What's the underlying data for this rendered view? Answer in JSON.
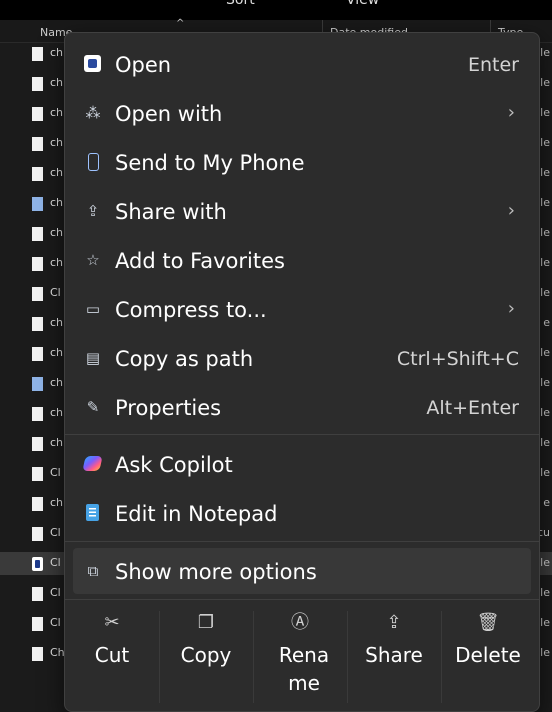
{
  "explorer": {
    "top_tabs": [
      "Sort",
      "View"
    ],
    "columns": {
      "name": "Name",
      "date": "Date modified",
      "type": "Type"
    },
    "files": [
      {
        "name": "ch",
        "type": "ile",
        "icon": "file-icon"
      },
      {
        "name": "ch",
        "type": "File",
        "icon": "file-icon"
      },
      {
        "name": "ch",
        "type": "ile",
        "icon": "file-icon"
      },
      {
        "name": "ch",
        "type": "le",
        "icon": "file-icon"
      },
      {
        "name": "ch",
        "type": "le",
        "icon": "file-icon"
      },
      {
        "name": "ch",
        "type": "le",
        "icon": "notepad-file-icon"
      },
      {
        "name": "ch",
        "type": "ile",
        "icon": "file-icon"
      },
      {
        "name": "ch",
        "type": "File",
        "icon": "file-icon"
      },
      {
        "name": "Cl",
        "type": "ile",
        "icon": "file-icon"
      },
      {
        "name": "ch",
        "type": "e",
        "icon": "file-icon"
      },
      {
        "name": "ch",
        "type": "le",
        "icon": "file-icon"
      },
      {
        "name": "ch",
        "type": "le",
        "icon": "notepad-file-icon"
      },
      {
        "name": "ch",
        "type": "ile",
        "icon": "file-icon"
      },
      {
        "name": "ch",
        "type": "File",
        "icon": "file-icon"
      },
      {
        "name": "Cl",
        "type": "ile",
        "icon": "file-icon"
      },
      {
        "name": "ch",
        "type": "e",
        "icon": "file-icon"
      },
      {
        "name": "Cl",
        "type": "ocu",
        "icon": "document-file-icon"
      },
      {
        "name": "Cl",
        "type": "ile",
        "icon": "app-file-icon"
      },
      {
        "name": "Cl",
        "type": "le",
        "icon": "file-icon"
      },
      {
        "name": "Cl",
        "type": "ile",
        "icon": "file-icon"
      },
      {
        "name": "Ch",
        "type": "ile",
        "icon": "file-icon"
      }
    ]
  },
  "menu": {
    "items": [
      {
        "label": "Open",
        "shortcut": "Enter",
        "icon": "app-icon"
      },
      {
        "label": "Open with",
        "submenu": "›",
        "icon": "open-with-icon",
        "icon_glyph": "⁂"
      },
      {
        "label": "Send to My Phone",
        "icon": "phone-icon"
      },
      {
        "label": "Share with",
        "submenu": "›",
        "icon": "share-icon",
        "icon_glyph": "⇪"
      },
      {
        "label": "Add to Favorites",
        "icon": "star-icon",
        "icon_glyph": "☆"
      },
      {
        "label": "Compress to...",
        "submenu": "›",
        "icon": "archive-icon",
        "icon_glyph": "▭"
      },
      {
        "label": "Copy as path",
        "shortcut": "Ctrl+Shift+C",
        "icon": "path-icon",
        "icon_glyph": "▤"
      },
      {
        "label": "Properties",
        "shortcut": "Alt+Enter",
        "icon": "wrench-icon",
        "icon_glyph": "✎"
      },
      {
        "label": "Ask Copilot",
        "icon": "copilot-icon"
      },
      {
        "label": "Edit in Notepad",
        "icon": "notepad-icon"
      },
      {
        "label": "Show more options",
        "icon": "more-options-icon",
        "icon_glyph": "⧉"
      }
    ],
    "bottom_bar": [
      {
        "label": "Cut",
        "icon": "scissors-icon",
        "glyph": "✂"
      },
      {
        "label": "Copy",
        "icon": "copy-icon",
        "glyph": "❐"
      },
      {
        "label": "Rena me",
        "icon": "rename-icon",
        "glyph": "Ⓐ"
      },
      {
        "label": "Share",
        "icon": "share-icon",
        "glyph": "⇪"
      },
      {
        "label": "Delete",
        "icon": "trash-icon",
        "glyph": "🗑"
      }
    ]
  }
}
